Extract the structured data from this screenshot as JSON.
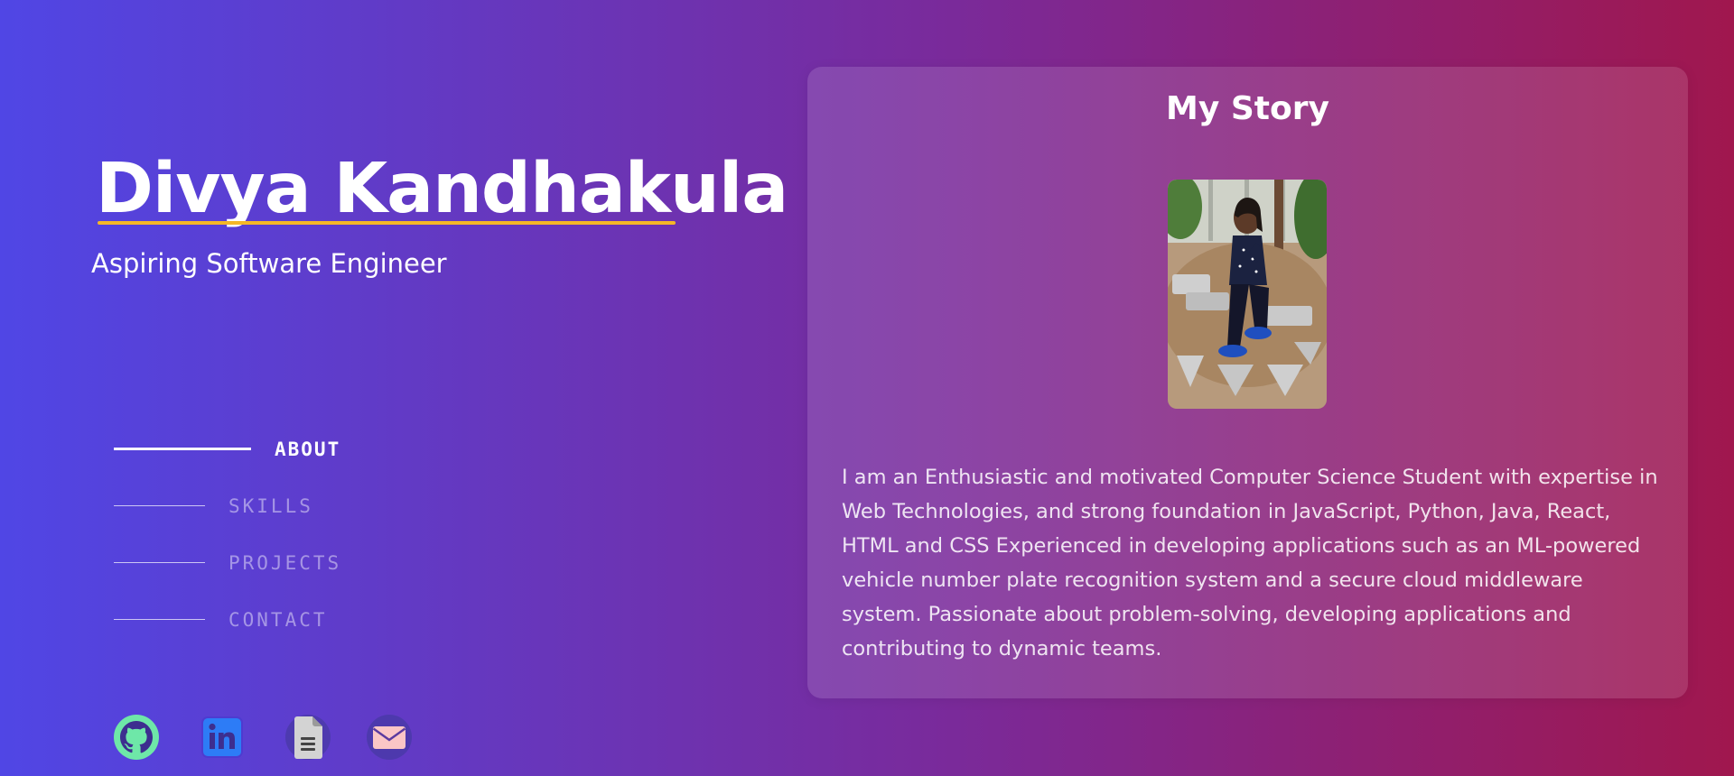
{
  "colors": {
    "gradient_start": "#5046E5",
    "gradient_mid": "#7A2A9A",
    "gradient_end": "#A0174E",
    "name_underline": "#F5B727",
    "github_icon": "#6EE7A8",
    "linkedin_icon": "#2D7CF6",
    "resume_icon": "#D3D3D3",
    "email_icon": "#FBC6C6"
  },
  "header": {
    "name": "Divya Kandhakula",
    "role": "Aspiring Software Engineer"
  },
  "nav": {
    "active": "about",
    "items": [
      {
        "id": "about",
        "label": "ABOUT"
      },
      {
        "id": "skills",
        "label": "SKILLS"
      },
      {
        "id": "projects",
        "label": "PROJECTS"
      },
      {
        "id": "contact",
        "label": "CONTACT"
      }
    ]
  },
  "socials": [
    {
      "id": "github",
      "icon": "github-icon"
    },
    {
      "id": "linkedin",
      "icon": "linkedin-icon"
    },
    {
      "id": "resume",
      "icon": "document-icon"
    },
    {
      "id": "email",
      "icon": "envelope-icon"
    }
  ],
  "story": {
    "title": "My Story",
    "body": "I am an Enthusiastic and motivated Computer Science Student with expertise in Web Technologies, and strong foundation in JavaScript, Python, Java, React, HTML and CSS Experienced in developing applications such as an ML-powered vehicle number plate recognition system and a secure cloud middleware system. Passionate about problem-solving, developing applications and contributing to dynamic teams."
  }
}
